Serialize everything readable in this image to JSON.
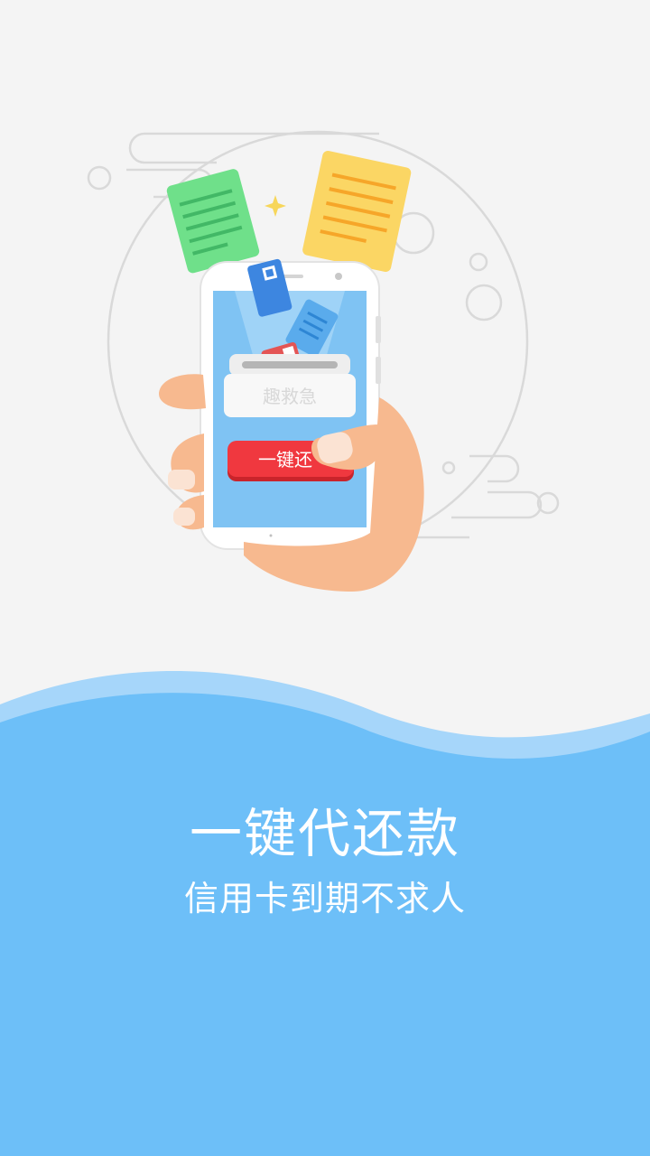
{
  "illustration": {
    "phone_card_label": "趣救急",
    "phone_button_label": "一键还"
  },
  "onboarding": {
    "headline": "一键代还款",
    "subline": "信用卡到期不求人"
  },
  "colors": {
    "background": "#f4f4f4",
    "wave_blue": "#6dbff8",
    "wave_light": "#a6d6fa",
    "button_red": "#f0383f",
    "screen_blue": "#7fc3f3",
    "skin": "#f7b98f"
  }
}
